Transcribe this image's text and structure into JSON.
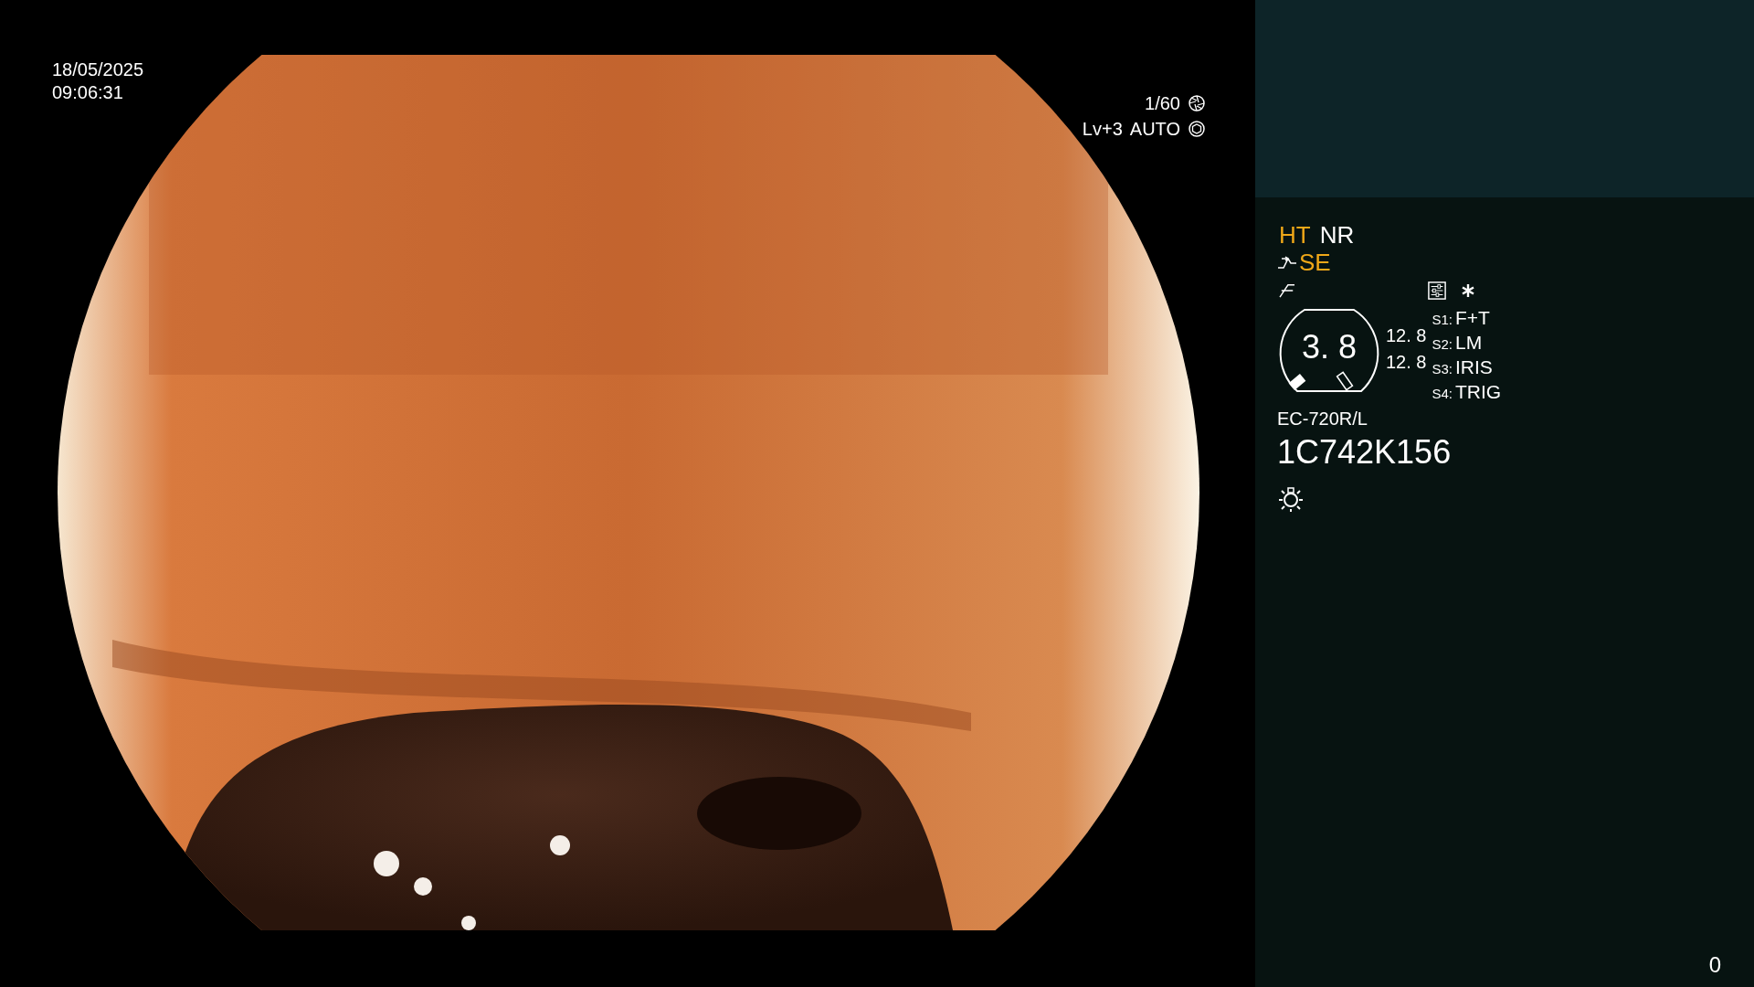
{
  "timestamp": {
    "date": "18/05/2025",
    "time": "09:06:31"
  },
  "camera": {
    "shutter": "1/60",
    "enhancement_level": "Lv+3",
    "iris_mode": "AUTO"
  },
  "modes": [
    {
      "label": "HT",
      "on": true
    },
    {
      "label": "NR",
      "on": false
    },
    {
      "label": "SE",
      "on": true
    }
  ],
  "zoom": {
    "value": "3. 8",
    "readings": [
      "12. 8",
      "12. 8"
    ]
  },
  "switches": [
    {
      "key": "S1:",
      "function": "F+T"
    },
    {
      "key": "S2:",
      "function": "LM"
    },
    {
      "key": "S3:",
      "function": "IRIS"
    },
    {
      "key": "S4:",
      "function": "TRIG"
    }
  ],
  "scope": {
    "model": "EC-720R/L",
    "serial": "1C742K156"
  },
  "counter": "0"
}
